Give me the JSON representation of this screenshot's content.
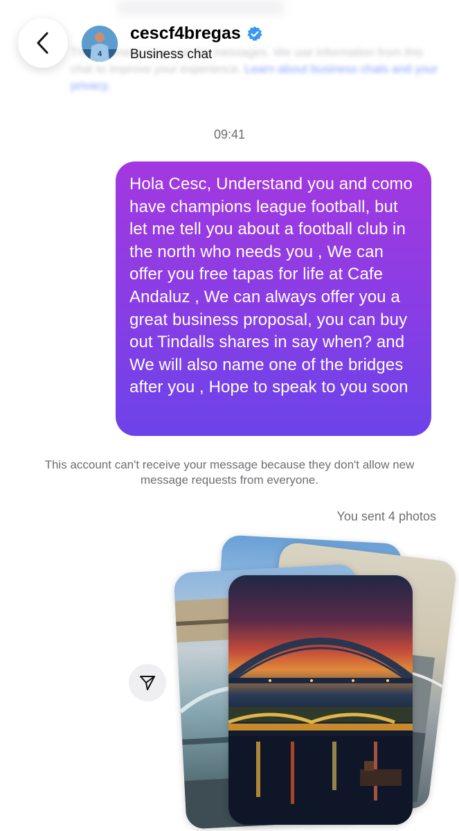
{
  "header": {
    "username": "cescf4bregas",
    "subtitle": "Business chat",
    "verified": true,
    "blurred_notice_line1": "This business may use the messages. We use information from this",
    "blurred_notice_line2": "chat to improve your experience.",
    "blurred_notice_link": "Learn about business chats and your privacy."
  },
  "conversation": {
    "timestamp": "09:41",
    "message": "Hola Cesc, Understand you and como have champions league football, but let me tell you about a football club in the north who needs you , We can offer you free tapas for life at Cafe Andaluz , We can always offer you a great business proposal, you can buy out Tindalls shares in say when? and We will also name one of the bridges after you , Hope to speak to you soon",
    "delivery_notice": "This account can't receive your message because they don't allow new message requests from everyone.",
    "photos_label": "You sent 4 photos",
    "photo_count": 4
  },
  "icons": {
    "back": "chevron-left-icon",
    "verified": "verified-badge-icon",
    "share": "share-send-icon"
  },
  "colors": {
    "bubble_top": "#a338e0",
    "bubble_bottom": "#6c43e9",
    "verified_blue": "#3897f0",
    "muted_text": "#6e6e73"
  }
}
